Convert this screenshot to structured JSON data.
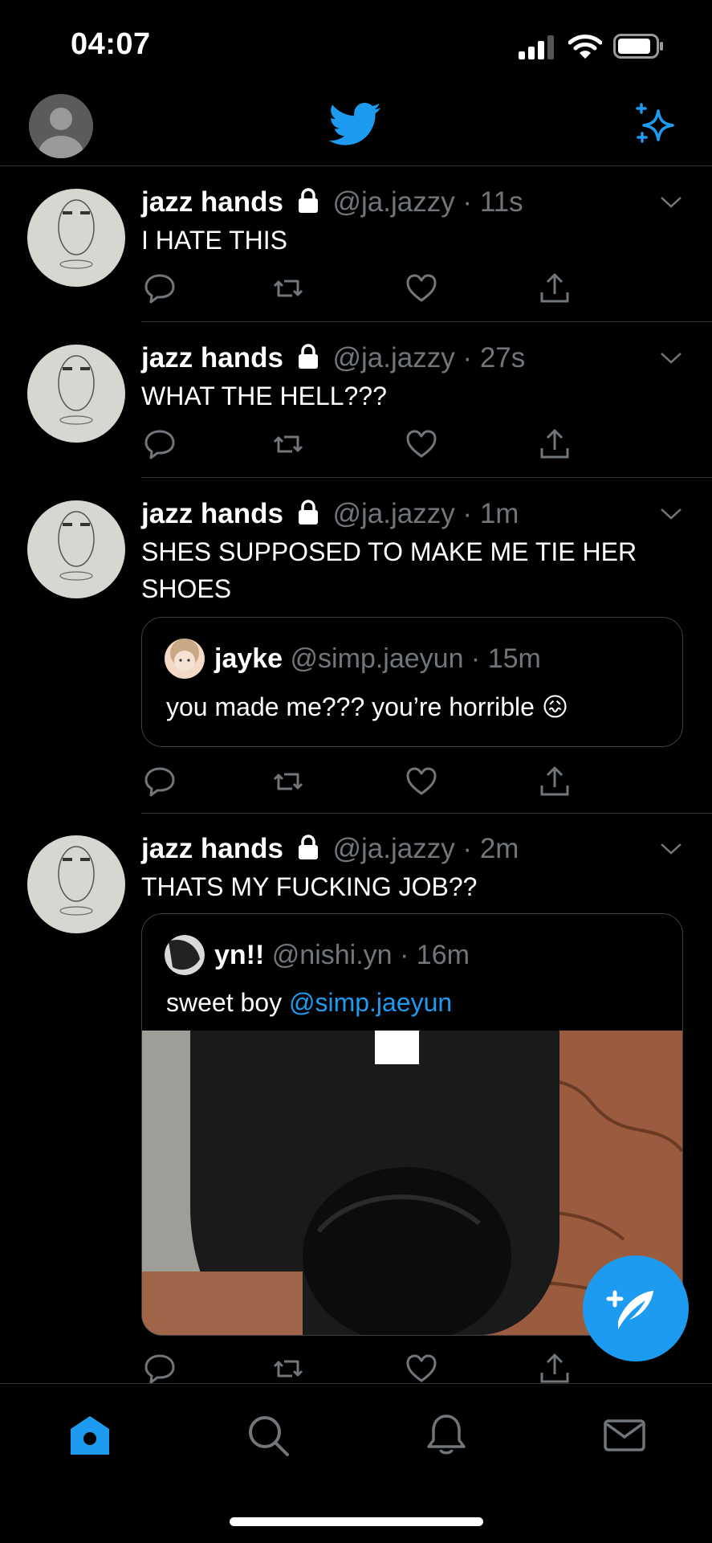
{
  "status_bar": {
    "time": "04:07"
  },
  "header": {
    "logo": "twitter-bird-icon",
    "sparkle": "sparkle-icon"
  },
  "tweets": [
    {
      "name": "jazz hands",
      "handle": "@ja.jazzy",
      "time": "11s",
      "text": "I HATE THIS"
    },
    {
      "name": "jazz hands",
      "handle": "@ja.jazzy",
      "time": "27s",
      "text": "WHAT THE HELL???"
    },
    {
      "name": "jazz hands",
      "handle": "@ja.jazzy",
      "time": "1m",
      "text": "SHES SUPPOSED TO MAKE ME TIE HER SHOES",
      "quote": {
        "name": "jayke",
        "handle": "@simp.jaeyun",
        "time": "15m",
        "text": "you made me??? you’re horrible",
        "emoji": "😖"
      }
    },
    {
      "name": "jazz hands",
      "handle": "@ja.jazzy",
      "time": "2m",
      "text": "THATS MY FUCKING JOB??",
      "quote": {
        "name": "yn!!",
        "handle": "@nishi.yn",
        "time": "16m",
        "text": "sweet boy ",
        "mention": "@simp.jaeyun"
      }
    }
  ],
  "separator": " · ",
  "nav": [
    "home-icon",
    "search-icon",
    "bell-icon",
    "mail-icon"
  ],
  "colors": {
    "accent": "#1d9bf0",
    "background": "#000000",
    "muted": "#71767b",
    "separator": "#2f3336"
  }
}
